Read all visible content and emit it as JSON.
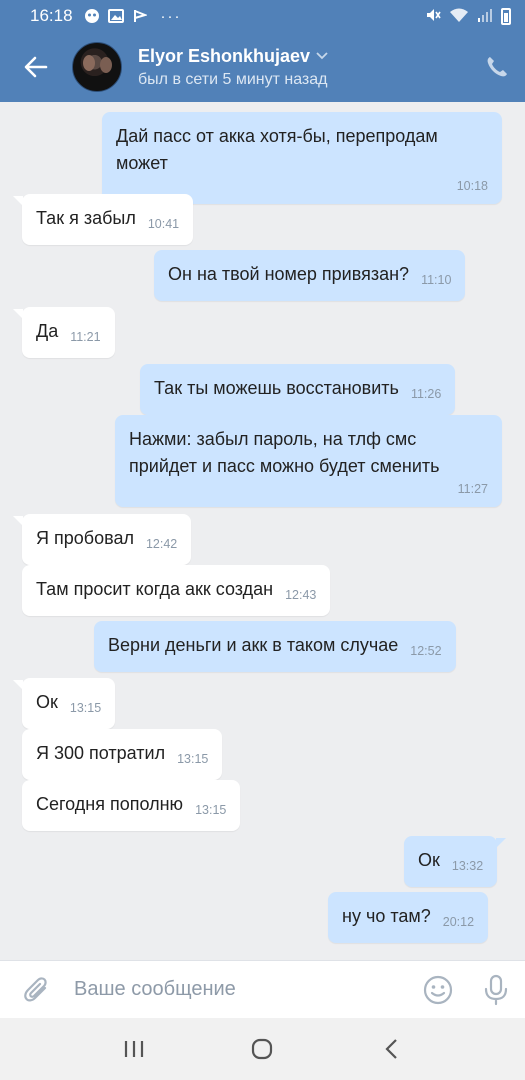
{
  "statusbar": {
    "time": "16:18",
    "dots": "···"
  },
  "header": {
    "name": "Elyor Eshonkhujaev",
    "status": "был в сети 5 минут назад"
  },
  "messages": [
    {
      "dir": "out",
      "text": "Дай пасс от акка хотя-бы, перепродам может",
      "time": "10:18"
    },
    {
      "dir": "in",
      "text": "Так я забыл",
      "time": "10:41"
    },
    {
      "dir": "out",
      "text": "Он на твой номер привязан?",
      "time": "11:10"
    },
    {
      "dir": "in",
      "text": "Да",
      "time": "11:21"
    },
    {
      "dir": "out",
      "text": "Так ты можешь восстановить",
      "time": "11:26"
    },
    {
      "dir": "out",
      "text": "Нажми: забыл пароль, на тлф смс прийдет и пасс можно будет сменить",
      "time": "11:27"
    },
    {
      "dir": "in",
      "text": "Я пробовал",
      "time": "12:42"
    },
    {
      "dir": "in",
      "text": "Там просит когда акк создан",
      "time": "12:43"
    },
    {
      "dir": "out",
      "text": "Верни деньги и акк в таком случае",
      "time": "12:52"
    },
    {
      "dir": "in",
      "text": "Ок",
      "time": "13:15"
    },
    {
      "dir": "in",
      "text": "Я 300 потратил",
      "time": "13:15"
    },
    {
      "dir": "in",
      "text": "Сегодня пополню",
      "time": "13:15"
    },
    {
      "dir": "out",
      "text": "Ок",
      "time": "13:32"
    },
    {
      "dir": "out",
      "text": "ну чо там?",
      "time": "20:12"
    }
  ],
  "composer": {
    "placeholder": "Ваше сообщение"
  },
  "colors": {
    "header": "#5181b8",
    "outgoing": "#cce4ff",
    "incoming": "#ffffff",
    "background": "#edeef0"
  },
  "icons": [
    "back-arrow-icon",
    "phone-icon",
    "paperclip-icon",
    "emoji-icon",
    "microphone-icon",
    "recents-icon",
    "home-icon",
    "back-nav-icon"
  ]
}
